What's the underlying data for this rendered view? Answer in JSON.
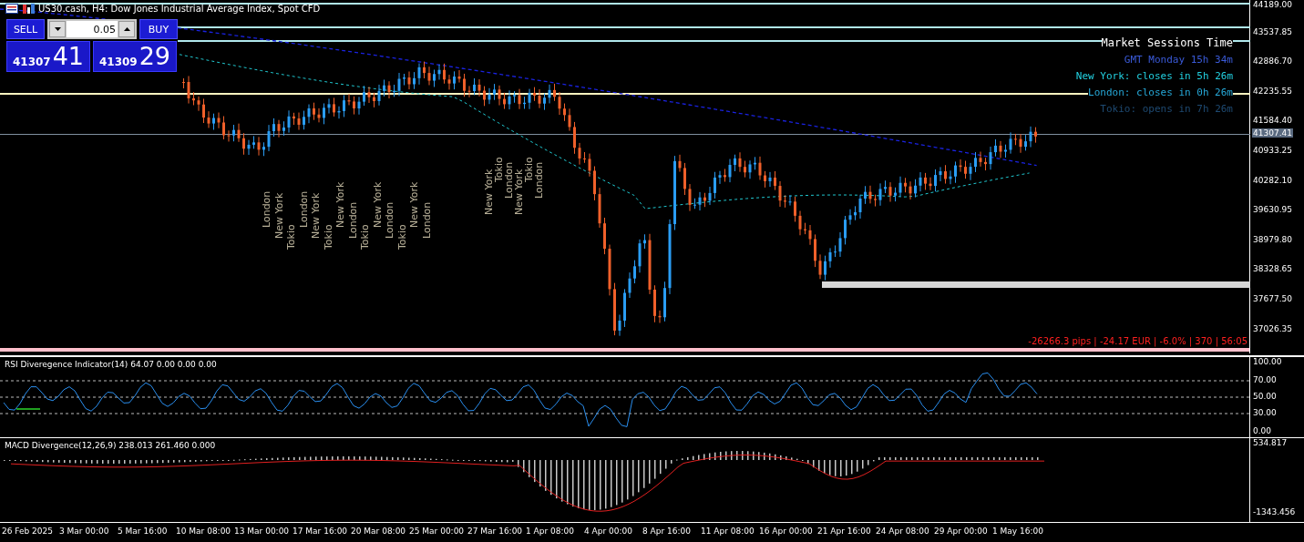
{
  "header": {
    "title": "US30.cash, H4:  Dow Jones Industrial Average Index, Spot CFD"
  },
  "trade_panel": {
    "sell": {
      "label": "SELL",
      "price_main": "41307",
      "price_big": "41"
    },
    "lot": {
      "value": "0.05"
    },
    "buy": {
      "label": "BUY",
      "price_main": "41309",
      "price_big": "29"
    }
  },
  "market_sessions": {
    "title": "Market Sessions Time",
    "lines": [
      {
        "text": "GMT Monday 15h 34m",
        "color": "#3a5ad8"
      },
      {
        "text": "New York: closes in 5h 26m",
        "color": "#22d0e0"
      },
      {
        "text": "London: closes in 0h 26m",
        "color": "#26a8d8"
      },
      {
        "text": "Tokio: opens in 7h 26m",
        "color": "#1e4a72"
      }
    ]
  },
  "session_labels": [
    "London",
    "New York",
    "Tokio",
    "London",
    "New York",
    "Tokio",
    "New York",
    "London",
    "Tokio",
    "New York",
    "London",
    "Tokio",
    "New York",
    "London",
    "New York",
    "Tokio",
    "London",
    "New York",
    "Tokio",
    "London"
  ],
  "price_axis": {
    "labels": [
      "44189.00",
      "43537.85",
      "42886.70",
      "42235.55",
      "41584.40",
      "40933.25",
      "40282.10",
      "39630.95",
      "38979.80",
      "38328.65",
      "37677.50",
      "37026.35"
    ],
    "current_price": "41307.41"
  },
  "status_text": "-26266.3 pips | -24.17 EUR | -6.0% | 370 | 56:05",
  "rsi_pane": {
    "title": "RSI Diveregence Indicator(14) 64.07 0.00 0.00 0.00",
    "axis_labels": [
      "100.00",
      "70.00",
      "50.00",
      "30.00",
      "0.00"
    ]
  },
  "macd_pane": {
    "title": "MACD Divergence(12,26,9) 238.013 261.460 0.000",
    "axis_labels": [
      "534.817",
      "-1343.456"
    ]
  },
  "time_axis": [
    "26 Feb 2025",
    "3 Mar 00:00",
    "5 Mar 16:00",
    "10 Mar 08:00",
    "13 Mar 00:00",
    "17 Mar 16:00",
    "20 Mar 08:00",
    "25 Mar 00:00",
    "27 Mar 16:00",
    "1 Apr 08:00",
    "4 Apr 00:00",
    "8 Apr 16:00",
    "11 Apr 08:00",
    "16 Apr 00:00",
    "21 Apr 16:00",
    "24 Apr 08:00",
    "29 Apr 00:00",
    "1 May 16:00"
  ]
}
